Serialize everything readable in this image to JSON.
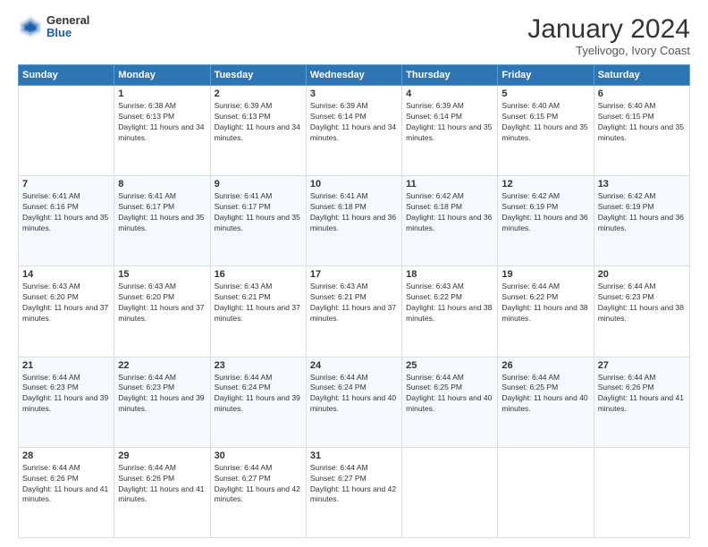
{
  "logo": {
    "general": "General",
    "blue": "Blue"
  },
  "title": "January 2024",
  "subtitle": "Tyelivogo, Ivory Coast",
  "days_header": [
    "Sunday",
    "Monday",
    "Tuesday",
    "Wednesday",
    "Thursday",
    "Friday",
    "Saturday"
  ],
  "weeks": [
    [
      {
        "num": "",
        "sunrise": "",
        "sunset": "",
        "daylight": ""
      },
      {
        "num": "1",
        "sunrise": "Sunrise: 6:38 AM",
        "sunset": "Sunset: 6:13 PM",
        "daylight": "Daylight: 11 hours and 34 minutes."
      },
      {
        "num": "2",
        "sunrise": "Sunrise: 6:39 AM",
        "sunset": "Sunset: 6:13 PM",
        "daylight": "Daylight: 11 hours and 34 minutes."
      },
      {
        "num": "3",
        "sunrise": "Sunrise: 6:39 AM",
        "sunset": "Sunset: 6:14 PM",
        "daylight": "Daylight: 11 hours and 34 minutes."
      },
      {
        "num": "4",
        "sunrise": "Sunrise: 6:39 AM",
        "sunset": "Sunset: 6:14 PM",
        "daylight": "Daylight: 11 hours and 35 minutes."
      },
      {
        "num": "5",
        "sunrise": "Sunrise: 6:40 AM",
        "sunset": "Sunset: 6:15 PM",
        "daylight": "Daylight: 11 hours and 35 minutes."
      },
      {
        "num": "6",
        "sunrise": "Sunrise: 6:40 AM",
        "sunset": "Sunset: 6:15 PM",
        "daylight": "Daylight: 11 hours and 35 minutes."
      }
    ],
    [
      {
        "num": "7",
        "sunrise": "Sunrise: 6:41 AM",
        "sunset": "Sunset: 6:16 PM",
        "daylight": "Daylight: 11 hours and 35 minutes."
      },
      {
        "num": "8",
        "sunrise": "Sunrise: 6:41 AM",
        "sunset": "Sunset: 6:17 PM",
        "daylight": "Daylight: 11 hours and 35 minutes."
      },
      {
        "num": "9",
        "sunrise": "Sunrise: 6:41 AM",
        "sunset": "Sunset: 6:17 PM",
        "daylight": "Daylight: 11 hours and 35 minutes."
      },
      {
        "num": "10",
        "sunrise": "Sunrise: 6:41 AM",
        "sunset": "Sunset: 6:18 PM",
        "daylight": "Daylight: 11 hours and 36 minutes."
      },
      {
        "num": "11",
        "sunrise": "Sunrise: 6:42 AM",
        "sunset": "Sunset: 6:18 PM",
        "daylight": "Daylight: 11 hours and 36 minutes."
      },
      {
        "num": "12",
        "sunrise": "Sunrise: 6:42 AM",
        "sunset": "Sunset: 6:19 PM",
        "daylight": "Daylight: 11 hours and 36 minutes."
      },
      {
        "num": "13",
        "sunrise": "Sunrise: 6:42 AM",
        "sunset": "Sunset: 6:19 PM",
        "daylight": "Daylight: 11 hours and 36 minutes."
      }
    ],
    [
      {
        "num": "14",
        "sunrise": "Sunrise: 6:43 AM",
        "sunset": "Sunset: 6:20 PM",
        "daylight": "Daylight: 11 hours and 37 minutes."
      },
      {
        "num": "15",
        "sunrise": "Sunrise: 6:43 AM",
        "sunset": "Sunset: 6:20 PM",
        "daylight": "Daylight: 11 hours and 37 minutes."
      },
      {
        "num": "16",
        "sunrise": "Sunrise: 6:43 AM",
        "sunset": "Sunset: 6:21 PM",
        "daylight": "Daylight: 11 hours and 37 minutes."
      },
      {
        "num": "17",
        "sunrise": "Sunrise: 6:43 AM",
        "sunset": "Sunset: 6:21 PM",
        "daylight": "Daylight: 11 hours and 37 minutes."
      },
      {
        "num": "18",
        "sunrise": "Sunrise: 6:43 AM",
        "sunset": "Sunset: 6:22 PM",
        "daylight": "Daylight: 11 hours and 38 minutes."
      },
      {
        "num": "19",
        "sunrise": "Sunrise: 6:44 AM",
        "sunset": "Sunset: 6:22 PM",
        "daylight": "Daylight: 11 hours and 38 minutes."
      },
      {
        "num": "20",
        "sunrise": "Sunrise: 6:44 AM",
        "sunset": "Sunset: 6:23 PM",
        "daylight": "Daylight: 11 hours and 38 minutes."
      }
    ],
    [
      {
        "num": "21",
        "sunrise": "Sunrise: 6:44 AM",
        "sunset": "Sunset: 6:23 PM",
        "daylight": "Daylight: 11 hours and 39 minutes."
      },
      {
        "num": "22",
        "sunrise": "Sunrise: 6:44 AM",
        "sunset": "Sunset: 6:23 PM",
        "daylight": "Daylight: 11 hours and 39 minutes."
      },
      {
        "num": "23",
        "sunrise": "Sunrise: 6:44 AM",
        "sunset": "Sunset: 6:24 PM",
        "daylight": "Daylight: 11 hours and 39 minutes."
      },
      {
        "num": "24",
        "sunrise": "Sunrise: 6:44 AM",
        "sunset": "Sunset: 6:24 PM",
        "daylight": "Daylight: 11 hours and 40 minutes."
      },
      {
        "num": "25",
        "sunrise": "Sunrise: 6:44 AM",
        "sunset": "Sunset: 6:25 PM",
        "daylight": "Daylight: 11 hours and 40 minutes."
      },
      {
        "num": "26",
        "sunrise": "Sunrise: 6:44 AM",
        "sunset": "Sunset: 6:25 PM",
        "daylight": "Daylight: 11 hours and 40 minutes."
      },
      {
        "num": "27",
        "sunrise": "Sunrise: 6:44 AM",
        "sunset": "Sunset: 6:26 PM",
        "daylight": "Daylight: 11 hours and 41 minutes."
      }
    ],
    [
      {
        "num": "28",
        "sunrise": "Sunrise: 6:44 AM",
        "sunset": "Sunset: 6:26 PM",
        "daylight": "Daylight: 11 hours and 41 minutes."
      },
      {
        "num": "29",
        "sunrise": "Sunrise: 6:44 AM",
        "sunset": "Sunset: 6:26 PM",
        "daylight": "Daylight: 11 hours and 41 minutes."
      },
      {
        "num": "30",
        "sunrise": "Sunrise: 6:44 AM",
        "sunset": "Sunset: 6:27 PM",
        "daylight": "Daylight: 11 hours and 42 minutes."
      },
      {
        "num": "31",
        "sunrise": "Sunrise: 6:44 AM",
        "sunset": "Sunset: 6:27 PM",
        "daylight": "Daylight: 11 hours and 42 minutes."
      },
      {
        "num": "",
        "sunrise": "",
        "sunset": "",
        "daylight": ""
      },
      {
        "num": "",
        "sunrise": "",
        "sunset": "",
        "daylight": ""
      },
      {
        "num": "",
        "sunrise": "",
        "sunset": "",
        "daylight": ""
      }
    ]
  ]
}
